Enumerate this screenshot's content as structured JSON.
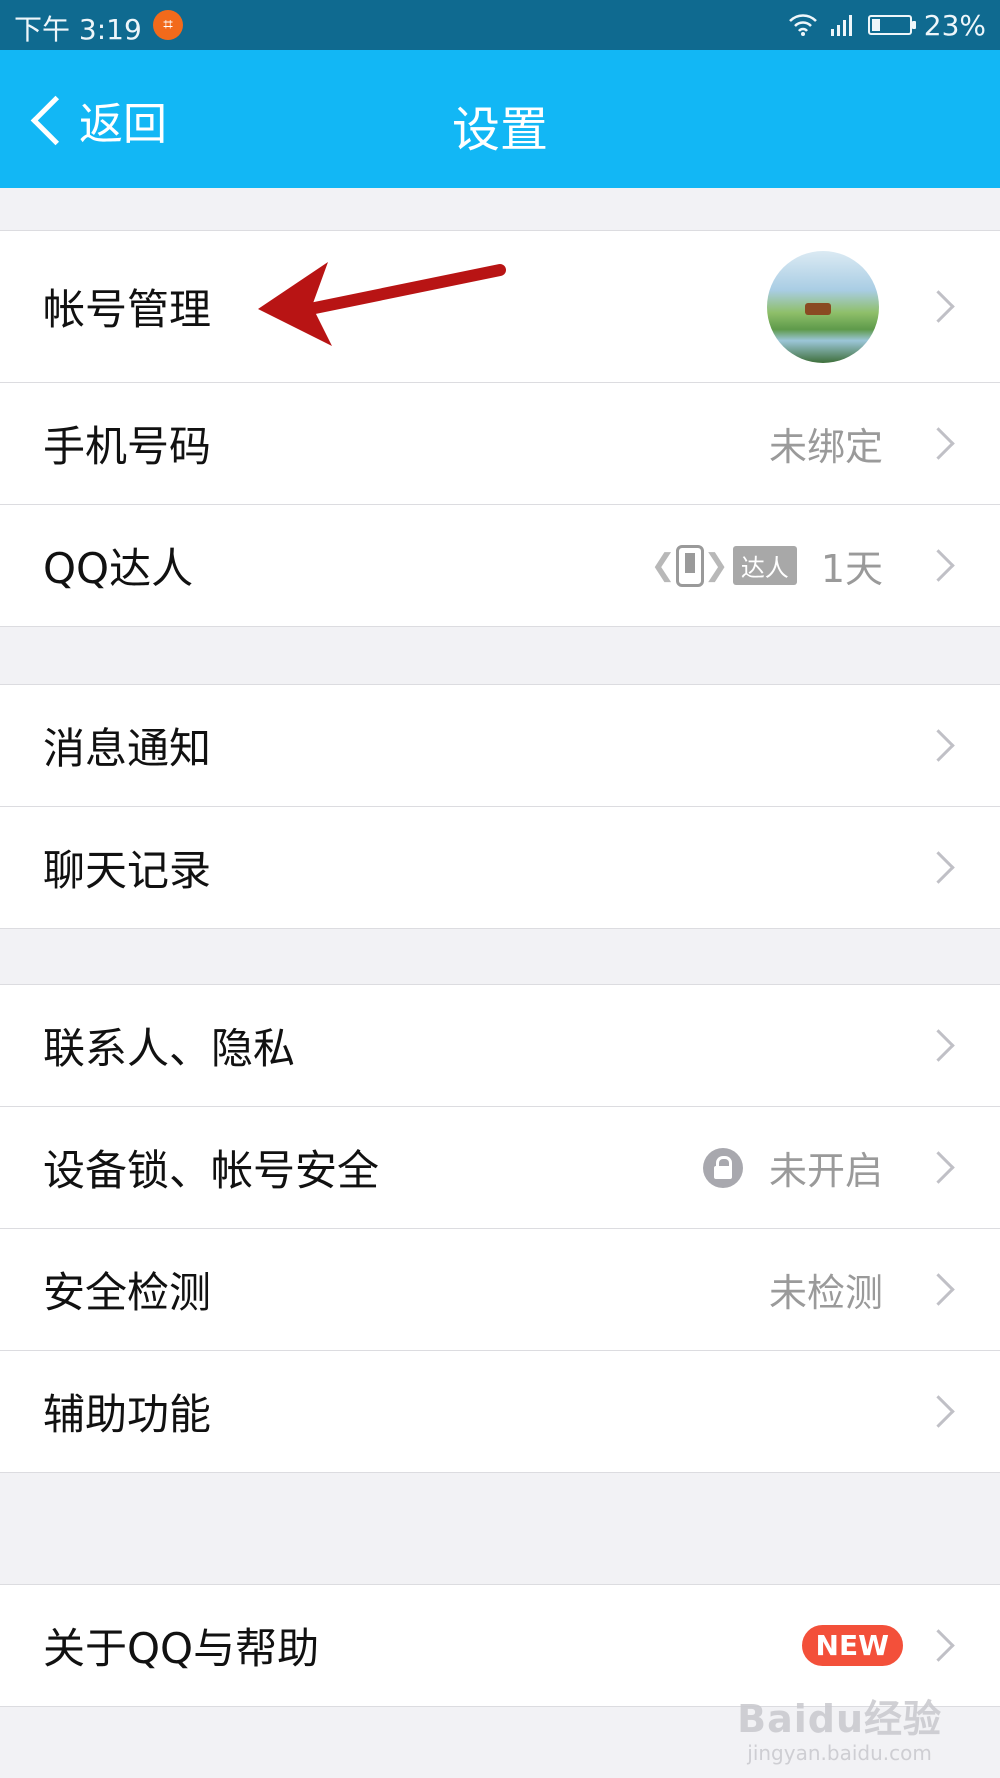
{
  "statusbar": {
    "time": "下午 3:19",
    "battery_text": "23%",
    "battery_level": 0.23
  },
  "navbar": {
    "back_label": "返回",
    "title": "设置"
  },
  "groups": [
    [
      {
        "label": "帐号管理",
        "right": "avatar"
      },
      {
        "label": "手机号码",
        "value": "未绑定"
      },
      {
        "label": "QQ达人",
        "badge_text": "达人",
        "value": "1天"
      }
    ],
    [
      {
        "label": "消息通知"
      },
      {
        "label": "聊天记录"
      }
    ],
    [
      {
        "label": "联系人、隐私"
      },
      {
        "label": "设备锁、帐号安全",
        "value": "未开启",
        "icon": "lock-icon"
      },
      {
        "label": "安全检测",
        "value": "未检测"
      },
      {
        "label": "辅助功能"
      }
    ],
    [
      {
        "label": "关于QQ与帮助",
        "new_badge": "NEW"
      }
    ]
  ],
  "colors": {
    "accent": "#12b7f5",
    "status_bar": "#0f6a90",
    "new_badge": "#f3503a",
    "annotation_arrow": "#b81414"
  },
  "watermark": {
    "logo": "Baidu经验",
    "url": "jingyan.baidu.com"
  }
}
